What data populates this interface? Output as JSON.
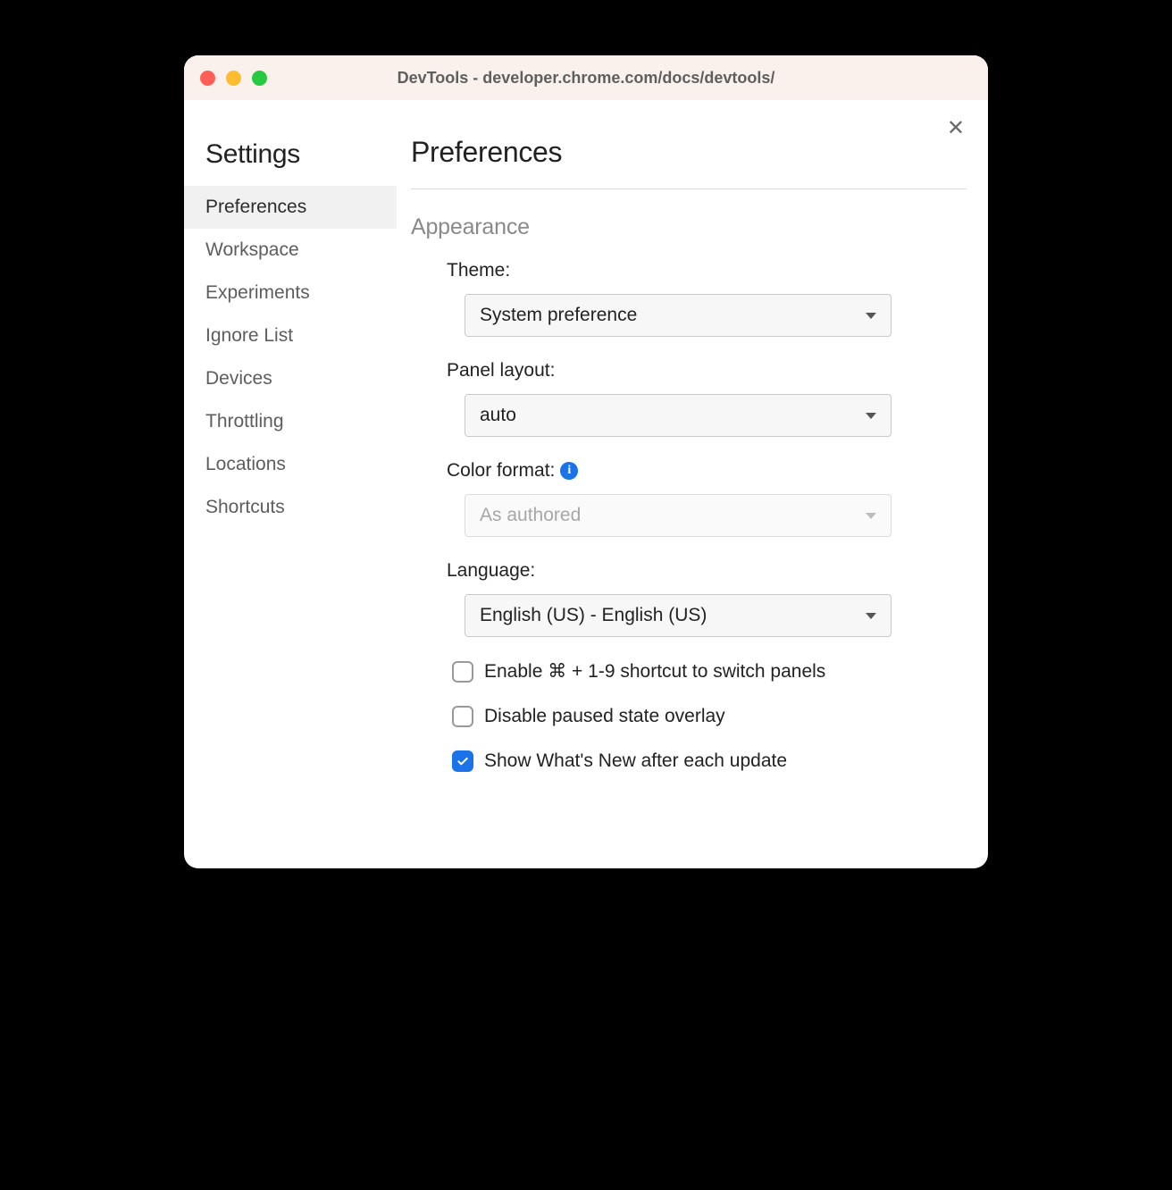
{
  "window": {
    "title": "DevTools - developer.chrome.com/docs/devtools/"
  },
  "sidebar": {
    "title": "Settings",
    "items": [
      {
        "label": "Preferences",
        "active": true
      },
      {
        "label": "Workspace",
        "active": false
      },
      {
        "label": "Experiments",
        "active": false
      },
      {
        "label": "Ignore List",
        "active": false
      },
      {
        "label": "Devices",
        "active": false
      },
      {
        "label": "Throttling",
        "active": false
      },
      {
        "label": "Locations",
        "active": false
      },
      {
        "label": "Shortcuts",
        "active": false
      }
    ]
  },
  "main": {
    "title": "Preferences",
    "section": "Appearance",
    "fields": {
      "theme": {
        "label": "Theme:",
        "value": "System preference",
        "disabled": false
      },
      "panel_layout": {
        "label": "Panel layout:",
        "value": "auto",
        "disabled": false
      },
      "color_format": {
        "label": "Color format:",
        "value": "As authored",
        "disabled": true,
        "info": true
      },
      "language": {
        "label": "Language:",
        "value": "English (US) - English (US)",
        "disabled": false
      }
    },
    "checkboxes": [
      {
        "label": "Enable ⌘ + 1-9 shortcut to switch panels",
        "checked": false
      },
      {
        "label": "Disable paused state overlay",
        "checked": false
      },
      {
        "label": "Show What's New after each update",
        "checked": true
      }
    ]
  }
}
